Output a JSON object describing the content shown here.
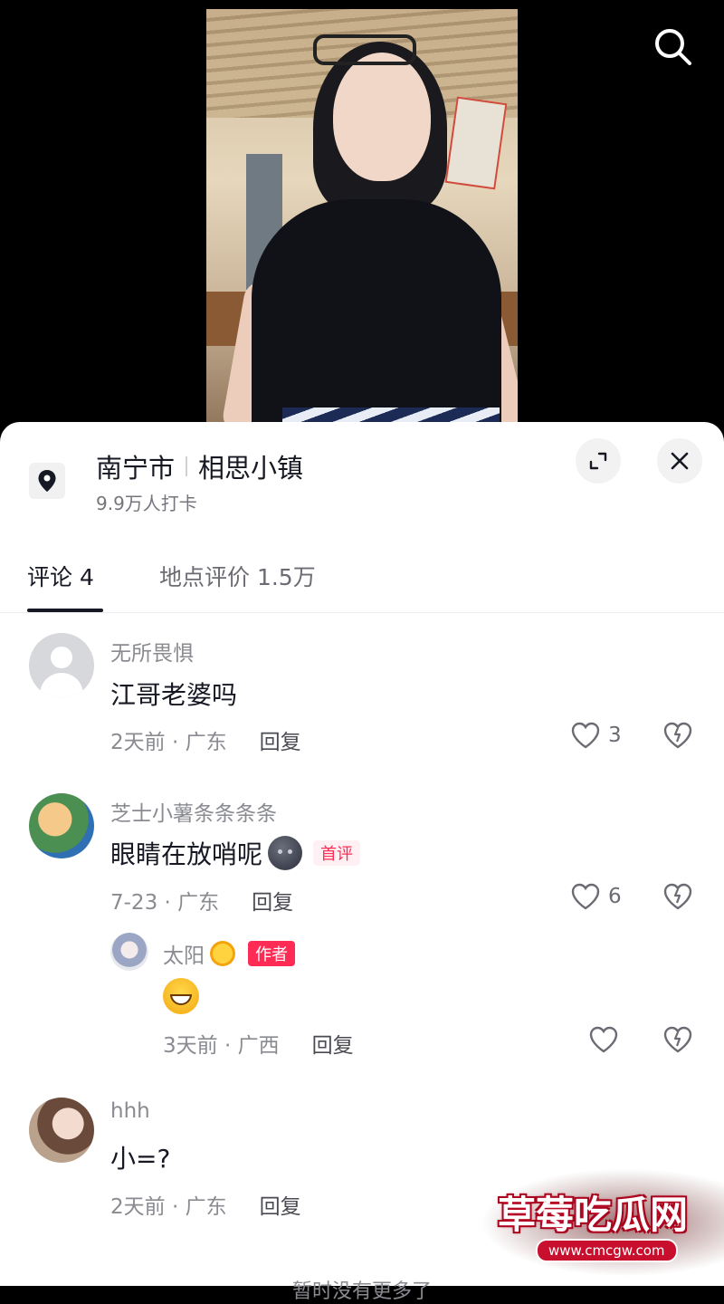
{
  "location": {
    "city": "南宁市",
    "place": "相思小镇",
    "checkins": "9.9万人打卡"
  },
  "tabs": [
    {
      "label": "评论 4"
    },
    {
      "label": "地点评价 1.5万"
    }
  ],
  "comments": [
    {
      "user": "无所畏惧",
      "text": "江哥老婆吗",
      "meta": "2天前 · 广东",
      "reply": "回复",
      "likes": "3"
    },
    {
      "user": "芝士小薯条条条条",
      "text": "眼睛在放哨呢",
      "tag": "首评",
      "meta": "7-23 · 广东",
      "reply": "回复",
      "likes": "6",
      "sub_reply": {
        "user": "太阳",
        "tag": "作者",
        "meta": "3天前 · 广西",
        "reply": "回复"
      }
    },
    {
      "user": "hhh",
      "text": "小=?",
      "meta": "2天前 · 广东",
      "reply": "回复"
    }
  ],
  "footer": "暂时没有更多了",
  "watermark": {
    "title": "草莓吃瓜网",
    "url": "www.cmcgw.com"
  },
  "colors": {
    "accent": "#fe2c55",
    "text_primary": "#161823",
    "text_secondary": "#8a8b91"
  },
  "icons": [
    "search-icon",
    "location-pin-icon",
    "expand-icon",
    "close-icon",
    "heart-icon",
    "broken-heart-icon"
  ]
}
